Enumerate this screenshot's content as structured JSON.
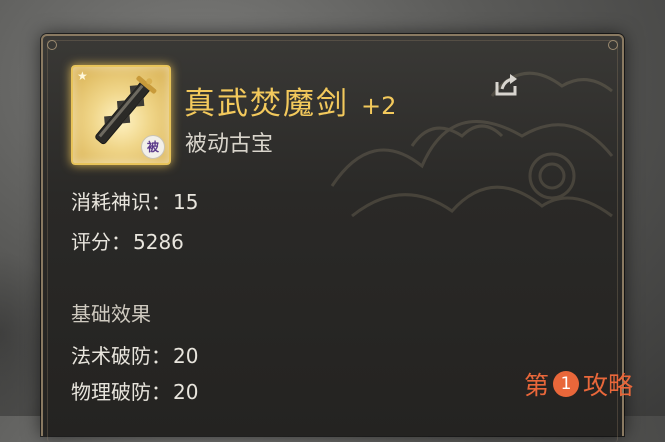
{
  "item": {
    "name": "真武焚魔剑",
    "level": "+2",
    "type": "被动古宝",
    "badge": "被",
    "icon": "sword-icon"
  },
  "stats": {
    "consume_label": "消耗神识：",
    "consume_value": "15",
    "score_label": "评分：",
    "score_value": "5286"
  },
  "base_effects": {
    "title": "基础效果",
    "items": [
      {
        "label": "法术破防：",
        "value": "20"
      },
      {
        "label": "物理破防：",
        "value": "20"
      }
    ]
  },
  "watermark": {
    "left": "第",
    "number": "1",
    "right": "攻略"
  },
  "colors": {
    "gold": "#f3c95c",
    "watermark": "#e9673a"
  }
}
